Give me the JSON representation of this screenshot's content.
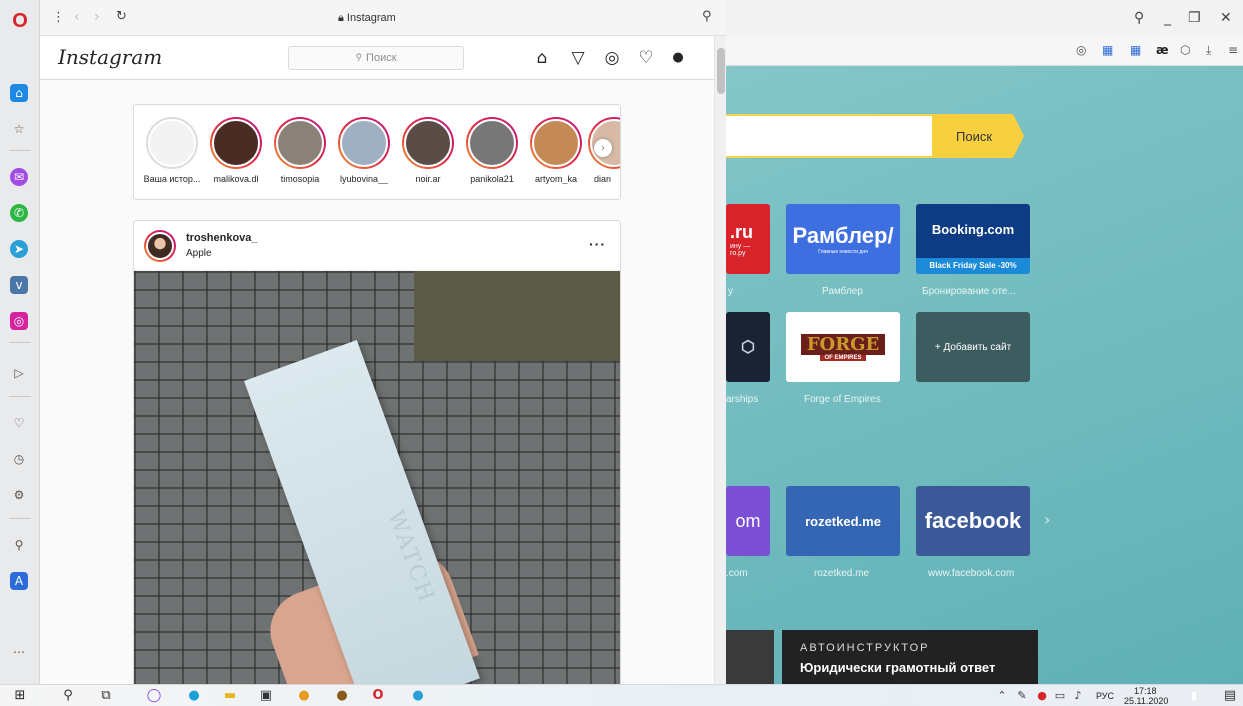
{
  "tab": {
    "title": "Instagram"
  },
  "instagram": {
    "logo": "Instagram",
    "search_placeholder": "Поиск",
    "stories": [
      {
        "name": "Ваша истор...",
        "seen": true
      },
      {
        "name": "malikova.dl",
        "seen": false
      },
      {
        "name": "timosopia",
        "seen": false
      },
      {
        "name": "lyubovina__",
        "seen": false
      },
      {
        "name": "noir.ar",
        "seen": false
      },
      {
        "name": "panikola21",
        "seen": false
      },
      {
        "name": "artyom_ka",
        "seen": false
      },
      {
        "name": "dian",
        "seen": false
      }
    ],
    "post": {
      "username": "troshenkova_",
      "location": "Apple",
      "image_text": "WATCH"
    }
  },
  "opera": {
    "search_button": "Поиск",
    "tiles": [
      {
        "title": ".ru",
        "sub": "ину —\nro.ру",
        "caption": "y"
      },
      {
        "title": "Рамблер/",
        "sub": "Главные новости дня",
        "caption": "Рамблер"
      },
      {
        "title": "Booking.com",
        "sub": "Black Friday Sale -30%",
        "caption": "Бронирование оте..."
      },
      {
        "title": "",
        "caption": "arships"
      },
      {
        "title": "FORGE",
        "sub": "OF EMPIRES",
        "caption": "Forge of Empires"
      },
      {
        "title": "+ Добавить сайт",
        "caption": ""
      },
      {
        "title": "om",
        "caption": ".com"
      },
      {
        "title": "rozetked.me",
        "caption": "rozetked.me"
      },
      {
        "title": "facebook",
        "caption": "www.facebook.com"
      }
    ],
    "ad": {
      "kicker": "АВТОИНСТРУКТОР",
      "title": "Юридически грамотный ответ"
    }
  },
  "taskbar": {
    "lang": "РУС",
    "time": "17:18",
    "date": "25.11.2020"
  },
  "colors": {
    "accent": "#f7cf3f",
    "teal_bg": "#7dc2c4",
    "opera_red": "#d8232a"
  }
}
